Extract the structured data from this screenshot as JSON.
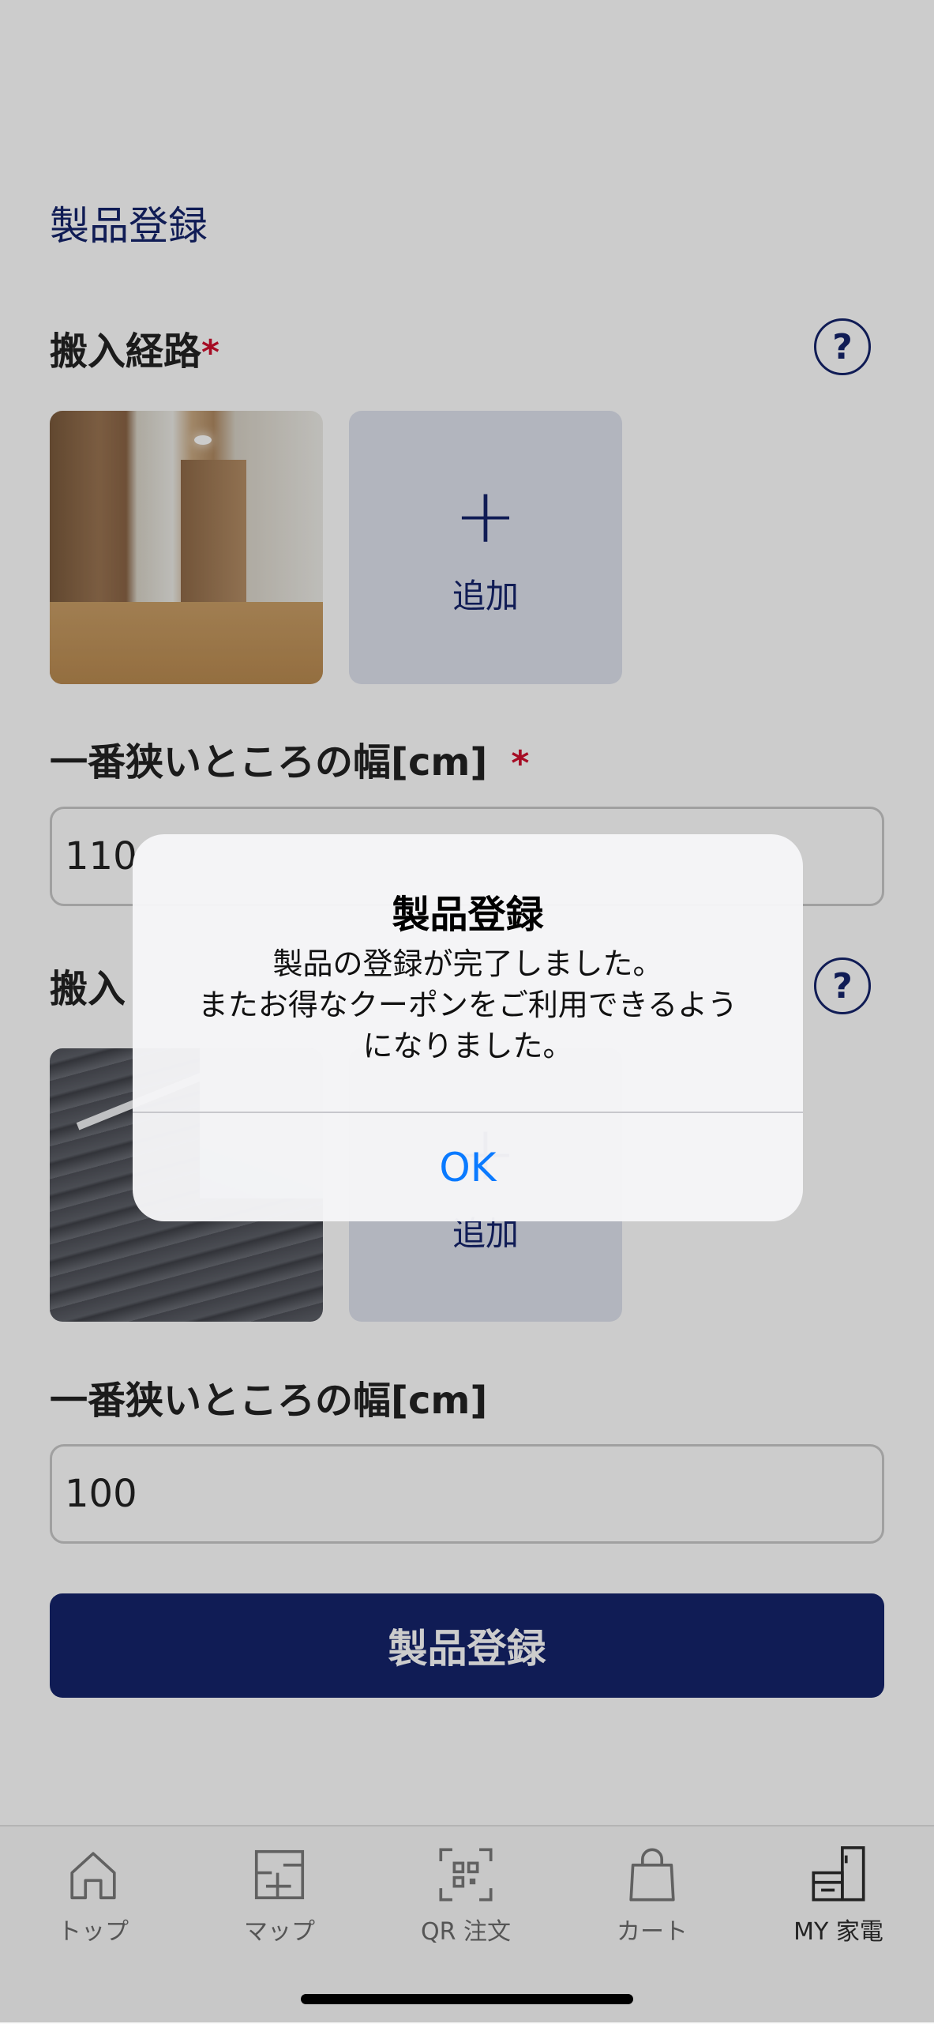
{
  "section_title": "製品登録",
  "carry_route": {
    "label": "搬入経路",
    "required_mark": "*",
    "help": "?",
    "add_label": "追加",
    "plus": "+"
  },
  "narrow_width_1": {
    "label": "一番狭いところの幅[cm]",
    "required_mark": "*",
    "value": "110"
  },
  "carry_route_2": {
    "label": "搬入",
    "help": "?",
    "add_label": "追加"
  },
  "narrow_width_2": {
    "label": "一番狭いところの幅[cm]",
    "value": "100"
  },
  "submit_label": "製品登録",
  "tabs": [
    {
      "label": "トップ",
      "icon": "home-icon"
    },
    {
      "label": "マップ",
      "icon": "floorplan-icon"
    },
    {
      "label": "QR 注文",
      "icon": "qr-icon"
    },
    {
      "label": "カート",
      "icon": "bag-icon"
    },
    {
      "label": "MY 家電",
      "icon": "appliance-icon",
      "active": true
    }
  ],
  "alert": {
    "title": "製品登録",
    "line1": "製品の登録が完了しました。",
    "line2": "またお得なクーポンをご利用できるよう",
    "line3": "になりました。",
    "ok_label": "OK"
  },
  "colors": {
    "brand": "#15246b",
    "required": "#d0102e",
    "ok_link": "#0a7aff"
  }
}
